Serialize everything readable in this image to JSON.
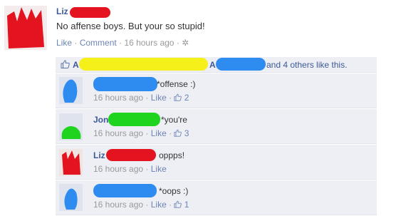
{
  "post": {
    "author": "Liz",
    "text": "No affense boys. But your so stupid!",
    "like_label": "Like",
    "comment_label": "Comment",
    "time": "16 hours ago"
  },
  "likes": {
    "name1": "A",
    "name2": "A",
    "suffix": "and 4 others like this."
  },
  "comments": [
    {
      "name": "",
      "text": "*offense :)",
      "time": "16 hours ago",
      "like_label": "Like",
      "likes": "2"
    },
    {
      "name": "Jon",
      "text": "*you're",
      "time": "16 hours ago",
      "like_label": "Like",
      "likes": "3"
    },
    {
      "name": "Liz",
      "text": "oppps!",
      "time": "16 hours ago",
      "like_label": "Like"
    },
    {
      "name": "",
      "text": "*oops :)",
      "time": "16 hours ago",
      "like_label": "Like",
      "likes": "1"
    }
  ],
  "colors": {
    "link": "#3b5998",
    "meta_link": "#6d84b4",
    "comment_bg": "#edeff4",
    "redact_red": "#e3141f",
    "redact_blue": "#2e8cf0",
    "redact_green": "#1ed41e",
    "redact_yellow": "#f6f01a"
  },
  "icons": [
    "thumbs-up-icon",
    "settings-gear-icon"
  ]
}
